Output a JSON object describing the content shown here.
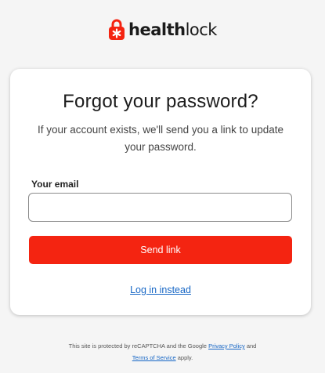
{
  "brand": {
    "name_bold": "health",
    "name_regular": "lock",
    "logo_icon": "padlock-medical-star-icon",
    "accent_color": "#f42411"
  },
  "card": {
    "title": "Forgot your password?",
    "subtitle": "If your account exists, we'll send you a link to update your password."
  },
  "form": {
    "email_label": "Your email",
    "email_value": "",
    "send_button_label": "Send link",
    "login_link_label": "Log in instead"
  },
  "footer": {
    "recaptcha_prefix": "This site is protected by reCAPTCHA and the Google",
    "privacy_link": "Privacy Policy",
    "and_text": "and",
    "terms_link": "Terms of Service",
    "apply_text": "apply."
  }
}
